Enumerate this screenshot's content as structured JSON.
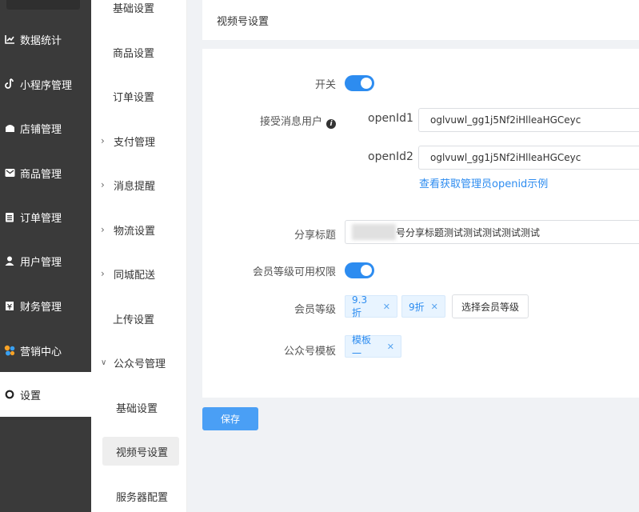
{
  "main_nav": {
    "items": [
      {
        "label": "数据统计",
        "icon": "chart-icon"
      },
      {
        "label": "小程序管理",
        "icon": "link-icon"
      },
      {
        "label": "店铺管理",
        "icon": "store-icon"
      },
      {
        "label": "商品管理",
        "icon": "mail-icon"
      },
      {
        "label": "订单管理",
        "icon": "clipboard-icon"
      },
      {
        "label": "用户管理",
        "icon": "user-icon"
      },
      {
        "label": "财务管理",
        "icon": "finance-icon"
      },
      {
        "label": "营销中心",
        "icon": "marketing-icon"
      },
      {
        "label": "设置",
        "icon": "gear-icon"
      }
    ]
  },
  "sub_nav": {
    "items": [
      {
        "label": "基础设置"
      },
      {
        "label": "商品设置"
      },
      {
        "label": "订单设置"
      },
      {
        "label": "支付管理"
      },
      {
        "label": "消息提醒"
      },
      {
        "label": "物流设置"
      },
      {
        "label": "同城配送"
      },
      {
        "label": "上传设置"
      },
      {
        "label": "公众号管理"
      },
      {
        "label": "基础设置"
      },
      {
        "label": "视频号设置"
      },
      {
        "label": "服务器配置"
      }
    ]
  },
  "header": {
    "title": "视频号设置"
  },
  "form": {
    "switch_label": "开关",
    "receiver_label": "接受消息用户",
    "openid1_label": "openId1",
    "openid1_value": "oglvuwl_gg1j5Nf2iHlleaHGCeyc",
    "openid2_label": "openId2",
    "openid2_value": "oglvuwl_gg1j5Nf2iHlleaHGCeyc",
    "openid_help_link": "查看获取管理员openid示例",
    "share_title_label": "分享标题",
    "share_title_value": "号分享标题测试测试测试测试测试",
    "member_perm_label": "会员等级可用权限",
    "member_level_label": "会员等级",
    "member_levels": [
      "9.3折",
      "9折"
    ],
    "select_level_button": "选择会员等级",
    "template_label": "公众号模板",
    "template_tag": "模板一",
    "switch_on": true,
    "member_perm_on": true
  },
  "save_button": "保存",
  "colors": {
    "primary": "#2d8cf0",
    "sidebar": "#3a3a3a"
  }
}
